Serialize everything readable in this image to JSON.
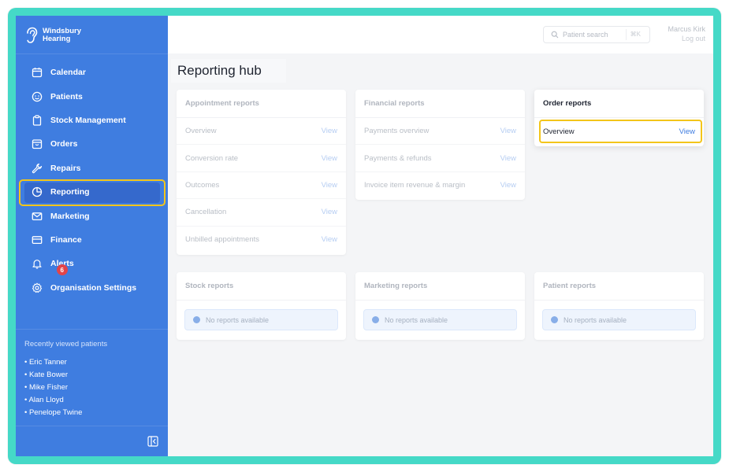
{
  "brand": {
    "line1": "Windsbury",
    "line2": "Hearing"
  },
  "sidebar": {
    "items": [
      {
        "label": "Calendar",
        "icon": "calendar-icon"
      },
      {
        "label": "Patients",
        "icon": "smile-icon"
      },
      {
        "label": "Stock Management",
        "icon": "clipboard-icon"
      },
      {
        "label": "Orders",
        "icon": "box-icon"
      },
      {
        "label": "Repairs",
        "icon": "wrench-icon"
      },
      {
        "label": "Reporting",
        "icon": "pie-chart-icon",
        "active": true
      },
      {
        "label": "Marketing",
        "icon": "mail-icon"
      },
      {
        "label": "Finance",
        "icon": "card-icon"
      },
      {
        "label": "Alerts",
        "icon": "bell-icon",
        "badge": "6"
      },
      {
        "label": "Organisation Settings",
        "icon": "gear-icon"
      }
    ],
    "recent_title": "Recently viewed patients",
    "recent": [
      "• Eric Tanner",
      "• Kate Bower",
      "• Mike Fisher",
      "• Alan Lloyd",
      "• Penelope Twine"
    ]
  },
  "topbar": {
    "search_placeholder": "Patient search",
    "search_shortcut": "⌘K",
    "user_name": "Marcus Kirk",
    "logout": "Log out"
  },
  "page": {
    "title": "Reporting hub"
  },
  "reports": {
    "appointment": {
      "title": "Appointment reports",
      "rows": [
        {
          "label": "Overview",
          "action": "View"
        },
        {
          "label": "Conversion rate",
          "action": "View"
        },
        {
          "label": "Outcomes",
          "action": "View"
        },
        {
          "label": "Cancellation",
          "action": "View"
        },
        {
          "label": "Unbilled appointments",
          "action": "View"
        }
      ]
    },
    "financial": {
      "title": "Financial reports",
      "rows": [
        {
          "label": "Payments overview",
          "action": "View"
        },
        {
          "label": "Payments & refunds",
          "action": "View"
        },
        {
          "label": "Invoice item revenue & margin",
          "action": "View"
        }
      ]
    },
    "order": {
      "title": "Order reports",
      "rows": [
        {
          "label": "Overview",
          "action": "View"
        }
      ]
    },
    "stock": {
      "title": "Stock reports",
      "empty": "No reports available"
    },
    "marketing": {
      "title": "Marketing reports",
      "empty": "No reports available"
    },
    "patient": {
      "title": "Patient reports",
      "empty": "No reports available"
    }
  },
  "colors": {
    "sidebar": "#3f7de0",
    "accent": "#3f7de0",
    "highlight": "#f3c51a",
    "frame": "#45d9c7",
    "badge": "#e2444a"
  }
}
